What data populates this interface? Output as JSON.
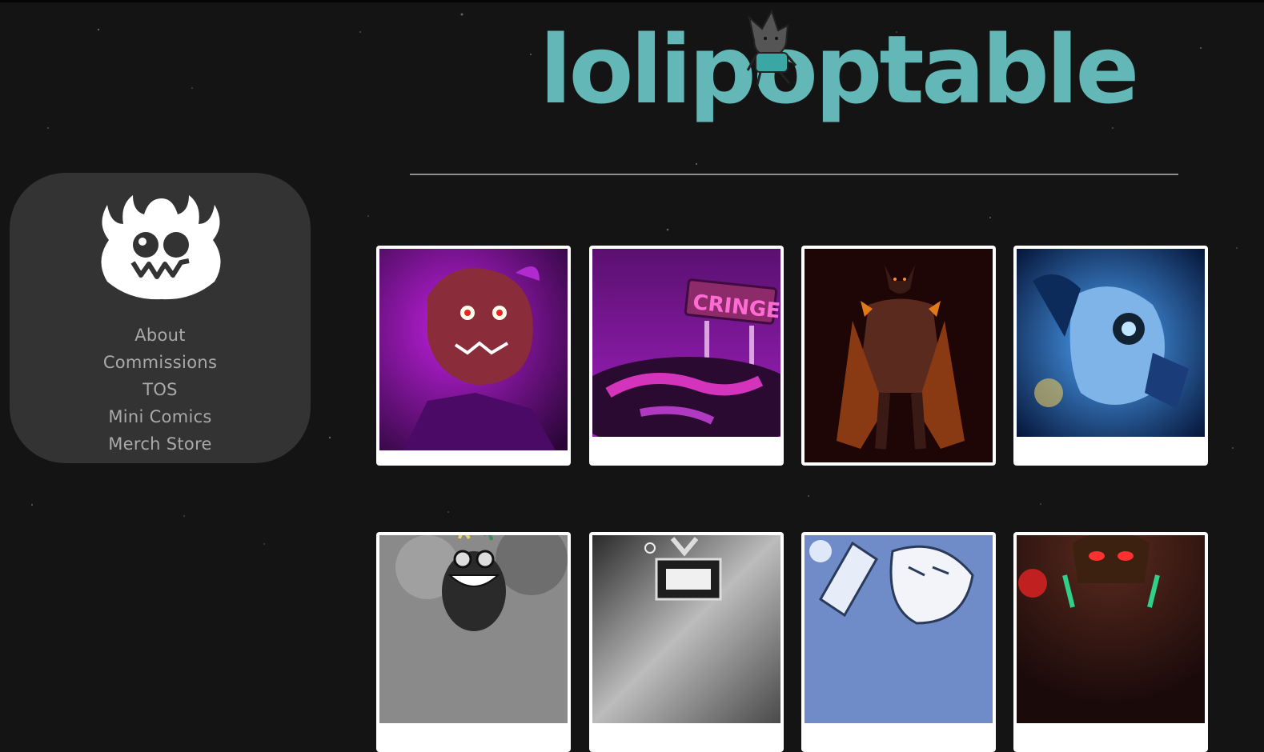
{
  "site": {
    "logo_text": "lolipoptable",
    "accent_color": "#63b8b7"
  },
  "sidebar": {
    "logo_icon": "monster-face-logo",
    "nav": [
      {
        "label": "About"
      },
      {
        "label": "Commissions"
      },
      {
        "label": "TOS"
      },
      {
        "label": "Mini Comics"
      },
      {
        "label": "Merch Store"
      }
    ]
  },
  "gallery": {
    "items": [
      {
        "icon": "artwork-purple-demon-portrait"
      },
      {
        "icon": "artwork-cringe-sign"
      },
      {
        "icon": "artwork-horned-warrior"
      },
      {
        "icon": "artwork-blue-robot-face"
      },
      {
        "icon": "artwork-grinning-goggles-character"
      },
      {
        "icon": "artwork-greyscale-robot"
      },
      {
        "icon": "artwork-white-robot-hammer"
      },
      {
        "icon": "artwork-red-eyed-robot"
      }
    ],
    "sign_text": "CRINGE"
  }
}
